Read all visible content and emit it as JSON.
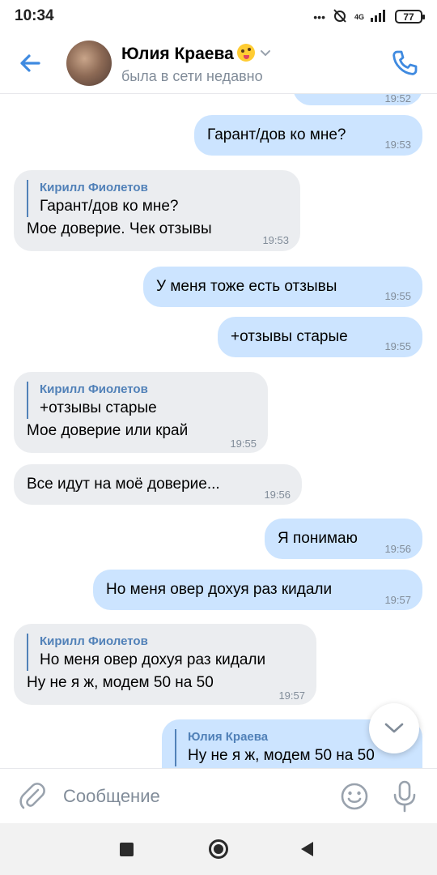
{
  "status_bar": {
    "time": "10:34",
    "network": "4G",
    "battery": "77"
  },
  "header": {
    "contact_name": "Юлия Краева",
    "contact_status": "была в сети недавно"
  },
  "messages": [
    {
      "dir": "out",
      "text": "",
      "time": "19:52"
    },
    {
      "dir": "out",
      "text": "Гарант/дов ко мне?",
      "time": "19:53"
    },
    {
      "dir": "in",
      "reply_author": "Кирилл Фиолетов",
      "reply_text": "Гарант/дов ко мне?",
      "text": "Мое доверие. Чек отзывы",
      "time": "19:53"
    },
    {
      "dir": "out",
      "text": "У меня тоже есть отзывы",
      "time": "19:55"
    },
    {
      "dir": "out",
      "text": "+отзывы старые",
      "time": "19:55"
    },
    {
      "dir": "in",
      "reply_author": "Кирилл Фиолетов",
      "reply_text": "+отзывы старые",
      "text": "Мое доверие или край",
      "time": "19:55"
    },
    {
      "dir": "in",
      "text": "Все идут на моё доверие...",
      "time": "19:56"
    },
    {
      "dir": "out",
      "text": "Я понимаю",
      "time": "19:56"
    },
    {
      "dir": "out",
      "text": "Но меня овер дохуя раз кидали",
      "time": "19:57"
    },
    {
      "dir": "in",
      "reply_author": "Кирилл Фиолетов",
      "reply_text": "Но меня овер дохуя раз кидали",
      "text": "Ну не я ж, модем 50 на 50",
      "time": "19:57"
    },
    {
      "dir": "out",
      "reply_author": "Юлия Краева",
      "reply_text": "Ну не я ж, модем 50 на 50",
      "text": "",
      "time": ""
    }
  ],
  "composer": {
    "placeholder": "Сообщение"
  },
  "colors": {
    "accent": "#3f8ae0",
    "out_bubble": "#cce4ff",
    "in_bubble": "#ebedf0",
    "reply_author": "#5181b8"
  },
  "icons": [
    "back-arrow-icon",
    "phone-icon",
    "chevron-down-icon",
    "paperclip-icon",
    "smile-icon",
    "microphone-icon"
  ]
}
